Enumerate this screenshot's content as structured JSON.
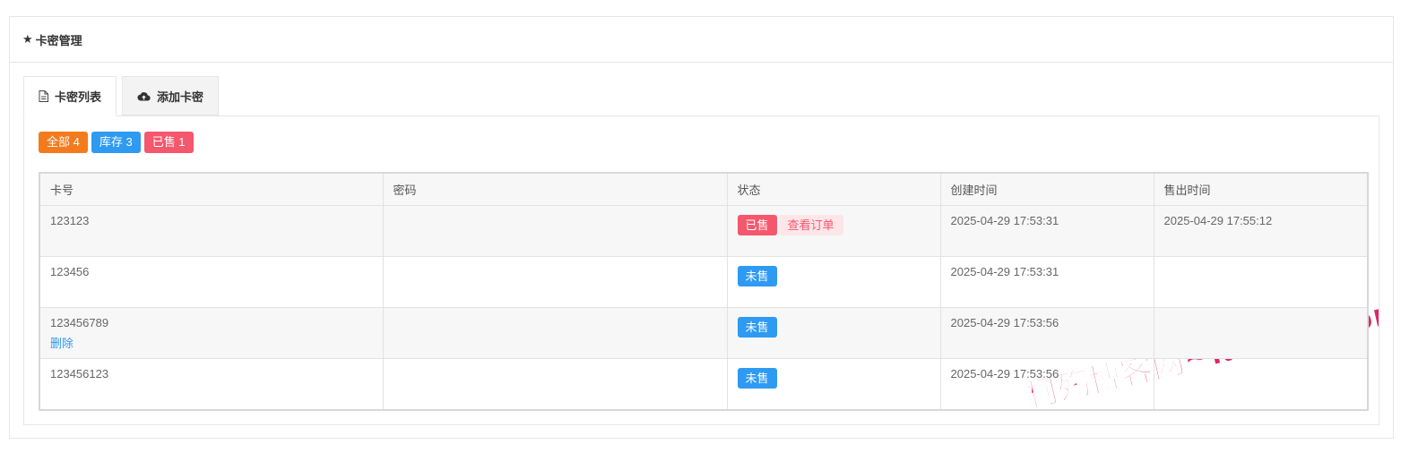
{
  "panel": {
    "title": "卡密管理"
  },
  "tabs": [
    {
      "label": "卡密列表",
      "icon": "document-icon",
      "active": true
    },
    {
      "label": "添加卡密",
      "icon": "cloud-upload-icon",
      "active": false
    }
  ],
  "filters": [
    {
      "label": "全部 4",
      "color": "#f37b1d"
    },
    {
      "label": "库存 3",
      "color": "#2e9af2"
    },
    {
      "label": "已售 1",
      "color": "#f5576c"
    }
  ],
  "table": {
    "headers": [
      "卡号",
      "密码",
      "状态",
      "创建时间",
      "售出时间"
    ],
    "rows": [
      {
        "card": "123123",
        "password": "",
        "status": "已售",
        "action": "查看订单",
        "created": "2025-04-29 17:53:31",
        "sold": "2025-04-29 17:55:12"
      },
      {
        "card": "123456",
        "password": "",
        "status": "未售",
        "created": "2025-04-29 17:53:31",
        "sold": ""
      },
      {
        "card": "123456789",
        "password": "",
        "status": "未售",
        "delete": "删除",
        "created": "2025-04-29 17:53:56",
        "sold": ""
      },
      {
        "card": "123456123",
        "password": "",
        "status": "未售",
        "created": "2025-04-29 17:53:56",
        "sold": ""
      }
    ]
  },
  "watermark": {
    "text": "柯殇博客网~ksbkw.com"
  },
  "colors": {
    "sold": "#f5576c",
    "unsold": "#2e9af2",
    "all": "#f37b1d"
  }
}
